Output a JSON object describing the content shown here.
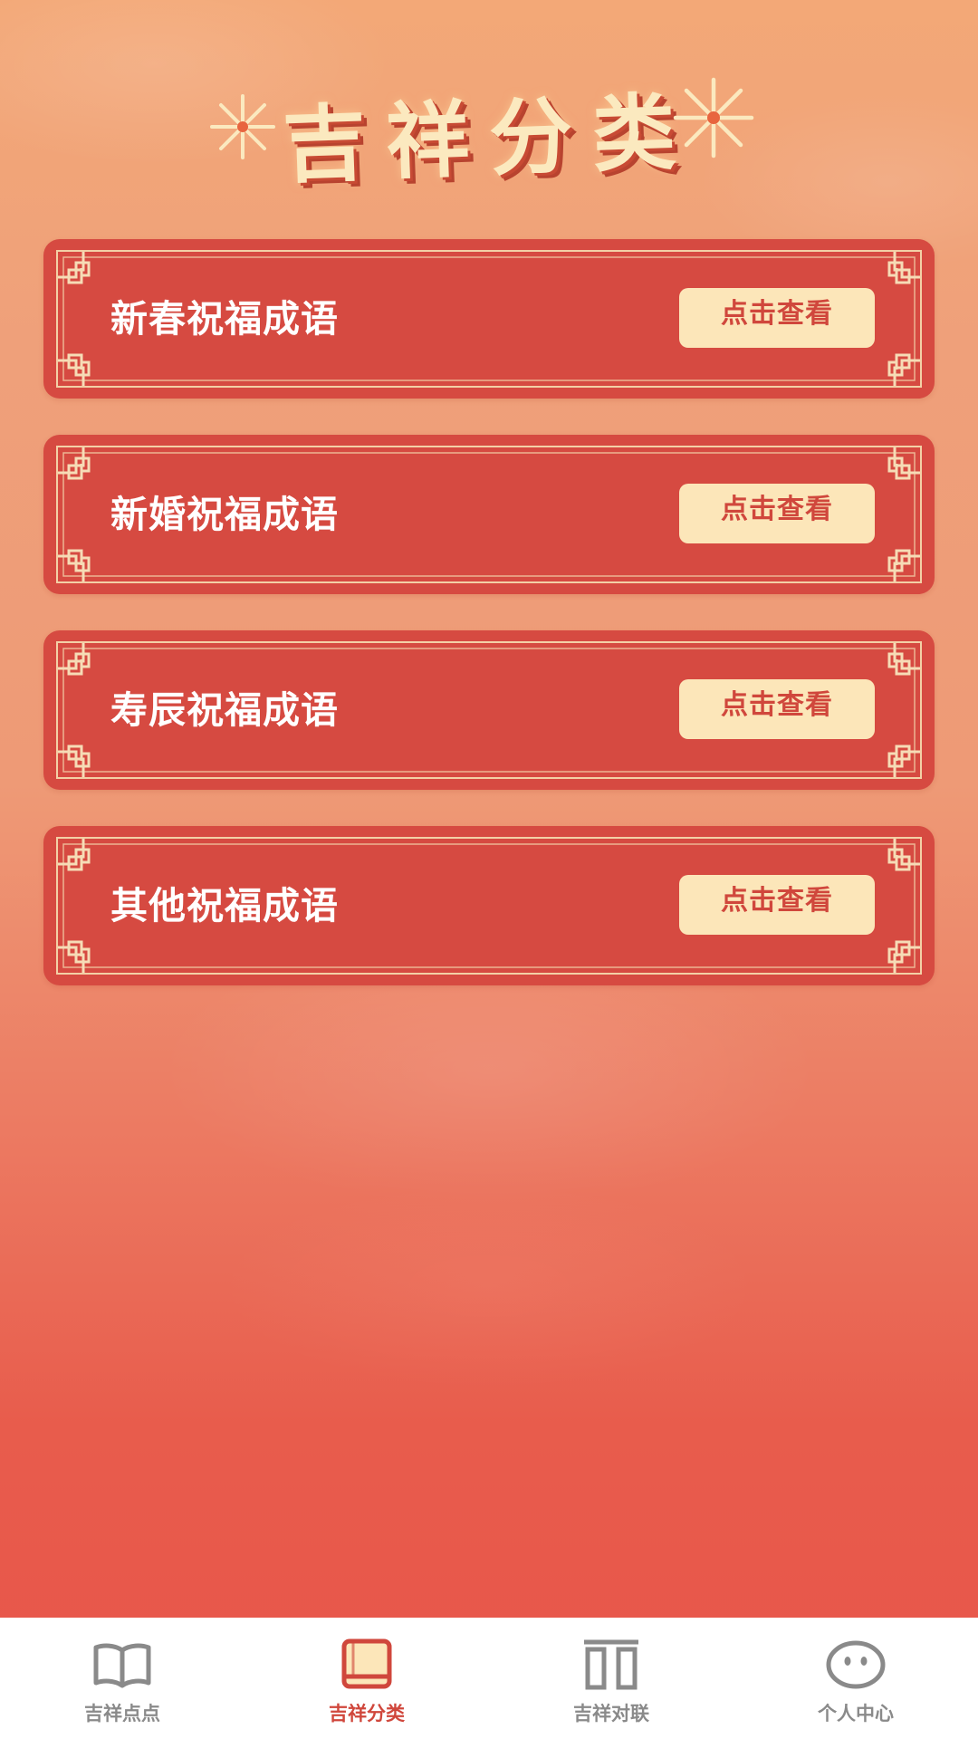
{
  "header": {
    "title": "吉祥分类"
  },
  "categories": [
    {
      "label": "新春祝福成语",
      "button": "点击查看"
    },
    {
      "label": "新婚祝福成语",
      "button": "点击查看"
    },
    {
      "label": "寿辰祝福成语",
      "button": "点击查看"
    },
    {
      "label": "其他祝福成语",
      "button": "点击查看"
    }
  ],
  "tabbar": {
    "items": [
      {
        "label": "吉祥点点",
        "icon": "open-book-icon",
        "active": false
      },
      {
        "label": "吉祥分类",
        "icon": "book-icon",
        "active": true
      },
      {
        "label": "吉祥对联",
        "icon": "couplet-icon",
        "active": false
      },
      {
        "label": "个人中心",
        "icon": "face-icon",
        "active": false
      }
    ]
  },
  "colors": {
    "card_red": "#d64a41",
    "button_cream": "#fce6b9",
    "accent_red": "#d0473c",
    "title_gold": "#fbe9bf",
    "tab_inactive": "#8a8a8a"
  }
}
